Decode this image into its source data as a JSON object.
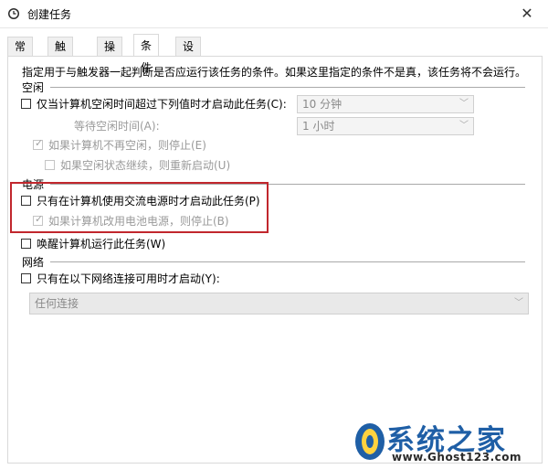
{
  "window": {
    "title": "创建任务",
    "close_glyph": "✕"
  },
  "tabs": [
    {
      "label": "常规",
      "active": false
    },
    {
      "label": "触发器",
      "active": false
    },
    {
      "label": "操作",
      "active": false
    },
    {
      "label": "条件",
      "active": true
    },
    {
      "label": "设置",
      "active": false
    }
  ],
  "description": "指定用于与触发器一起判断是否应运行该任务的条件。如果这里指定的条件不是真，该任务将不会运行。",
  "idle": {
    "section": "空闲",
    "start_if_idle": {
      "label": "仅当计算机空闲时间超过下列值时才启动此任务(C):",
      "checked": false
    },
    "idle_duration_value": "10 分钟",
    "wait_label": "等待空闲时间(A):",
    "wait_value": "1 小时",
    "stop_if_not_idle": {
      "label": "如果计算机不再空闲，则停止(E)",
      "checked": true
    },
    "restart_if_idle": {
      "label": "如果空闲状态继续，则重新启动(U)",
      "checked": false
    }
  },
  "power": {
    "section": "电源",
    "ac_only": {
      "label": "只有在计算机使用交流电源时才启动此任务(P)",
      "checked": false
    },
    "stop_on_battery": {
      "label": "如果计算机改用电池电源，则停止(B)",
      "checked": true
    },
    "wake": {
      "label": "唤醒计算机运行此任务(W)",
      "checked": false
    }
  },
  "network": {
    "section": "网络",
    "only_if_network": {
      "label": "只有在以下网络连接可用时才启动(Y):",
      "checked": false
    },
    "connection_value": "任何连接"
  },
  "watermark": {
    "brand": "系统之家",
    "url": "www.Ghost123.com"
  },
  "colors": {
    "highlight": "#c1272d",
    "brand": "#1f5fa6"
  },
  "icons": {
    "app": "clock-icon",
    "chevron": "chevron-down-icon",
    "check": "checkmark-icon"
  }
}
